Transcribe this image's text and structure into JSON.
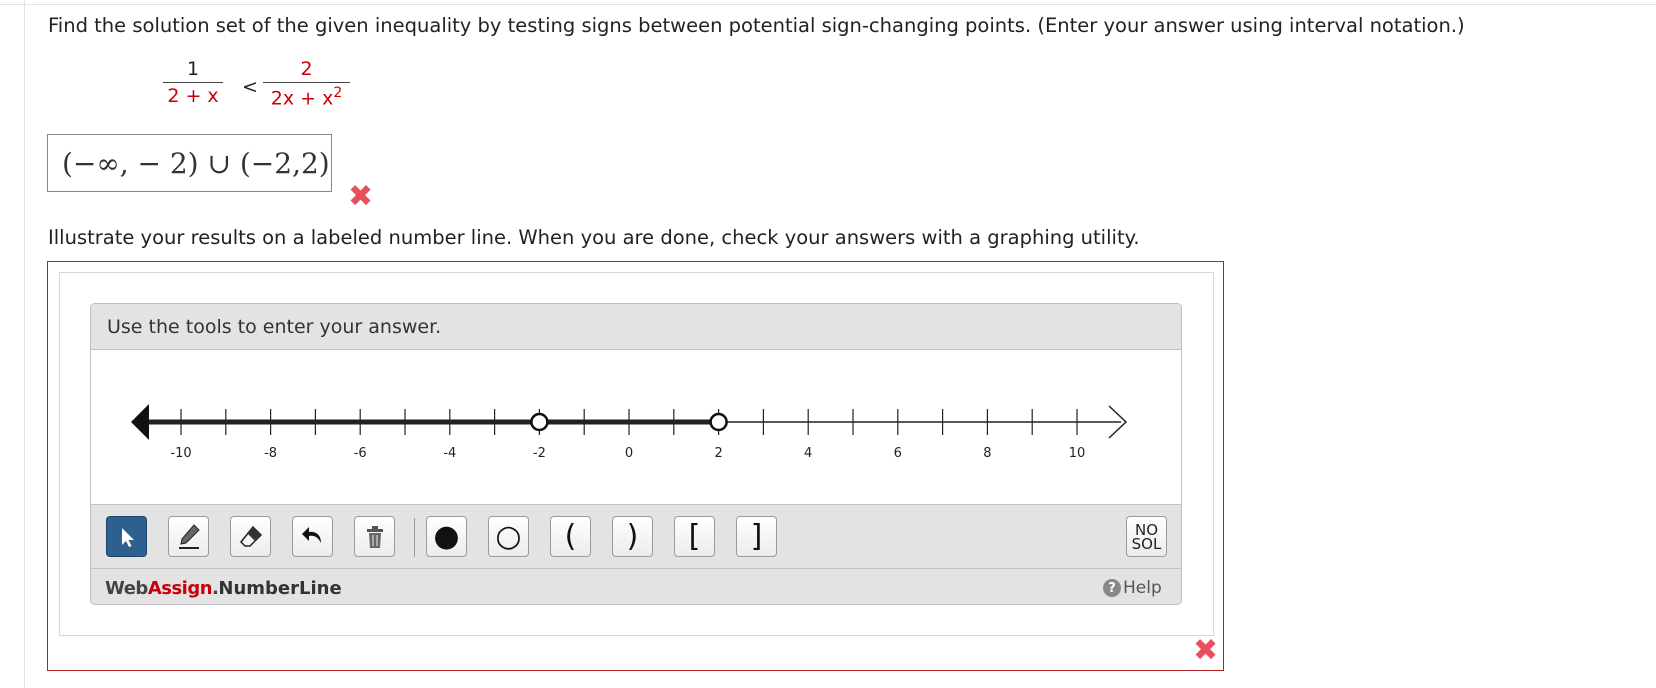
{
  "question1": {
    "prompt": "Find the solution set of the given inequality by testing signs between potential sign-changing points. (Enter your answer using interval notation.)",
    "lhs_numerator": "1",
    "lhs_denominator": "2 + x",
    "operator": "<",
    "rhs_numerator": "2",
    "rhs_denominator": "2x + x",
    "rhs_denominator_exponent": "2",
    "answer": "(−∞, − 2) ∪ (−2,2)",
    "status_icon": "incorrect-x-icon"
  },
  "question2": {
    "prompt": "Illustrate your results on a labeled number line. When you are done, check your answers with a graphing utility.",
    "status_icon": "incorrect-x-icon"
  },
  "widget": {
    "instructions": "Use the tools to enter your answer.",
    "axis": {
      "min": -11,
      "max": 11,
      "tick_step": 1,
      "labels": [
        "-10",
        "-8",
        "-6",
        "-4",
        "-2",
        "0",
        "2",
        "4",
        "6",
        "8",
        "10"
      ]
    },
    "intervals": [
      {
        "from": "-inf",
        "to": -2,
        "left": "arrow",
        "right": "open"
      },
      {
        "from": -2,
        "to": 2,
        "left": "open",
        "right": "open"
      }
    ],
    "tools": [
      {
        "name": "pointer-tool",
        "icon": "cursor-arrow-icon",
        "active": true
      },
      {
        "name": "draw-tool",
        "icon": "pencil-icon"
      },
      {
        "name": "erase-tool",
        "icon": "eraser-icon"
      },
      {
        "name": "undo-tool",
        "icon": "undo-icon"
      },
      {
        "name": "delete-tool",
        "icon": "trash-icon"
      },
      {
        "name": "closed-point-tool",
        "icon": "filled-dot-icon",
        "glyph": "●"
      },
      {
        "name": "open-point-tool",
        "icon": "open-dot-icon",
        "glyph": "○"
      },
      {
        "name": "left-paren-tool",
        "icon": "left-paren-icon",
        "glyph": "("
      },
      {
        "name": "right-paren-tool",
        "icon": "right-paren-icon",
        "glyph": ")"
      },
      {
        "name": "left-bracket-tool",
        "icon": "left-bracket-icon",
        "glyph": "["
      },
      {
        "name": "right-bracket-tool",
        "icon": "right-bracket-icon",
        "glyph": "]"
      }
    ],
    "no_solution": {
      "line1": "NO",
      "line2": "SOL"
    },
    "brand": {
      "web": "Web",
      "assign": "Assign",
      "dot": ".",
      "product": "NumberLine"
    },
    "help_label": "Help",
    "help_icon": "question-mark-icon"
  },
  "colors": {
    "accent_red": "#c8000a",
    "error_red": "#e8505b",
    "active_tool": "#2d5f8f",
    "panel_gray": "#e3e3e3"
  }
}
